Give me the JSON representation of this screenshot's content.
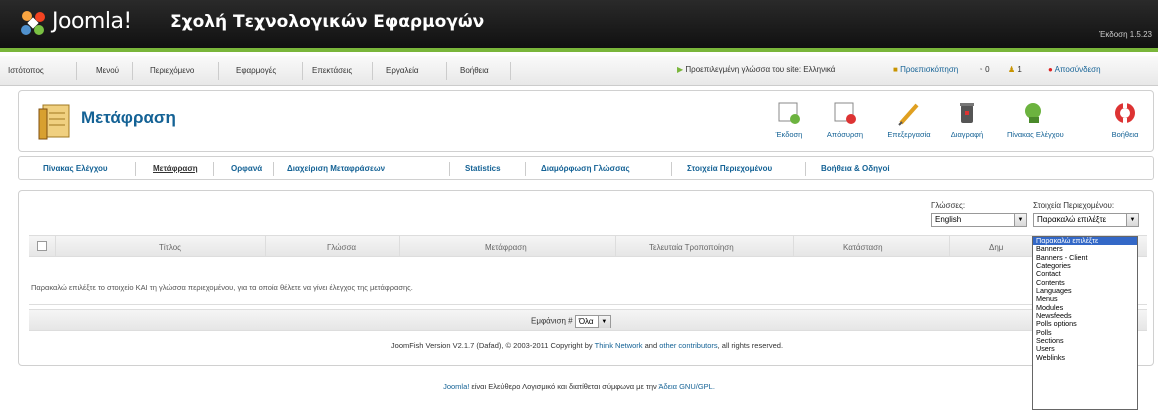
{
  "header": {
    "logo_text": "Joomla!",
    "site_name": "Σχολή Τεχνολογικών Εφαρμογών",
    "version": "Έκδοση 1.5.23"
  },
  "menu": {
    "items": [
      "Ιστότοπος",
      "Μενού",
      "Περιεχόμενο",
      "Εφαρμογές",
      "Επεκτάσεις",
      "Εργαλεία",
      "Βοήθεια"
    ],
    "default_lang": "Προεπιλεγμένη γλώσσα του site: Ελληνικά",
    "preview": "Προεπισκόπηση",
    "messages": "0",
    "users": "1",
    "logout": "Αποσύνδεση"
  },
  "toolbar": {
    "title": "Μετάφραση",
    "buttons": [
      "Έκδοση",
      "Απόσυρση",
      "Επεξεργασία",
      "Διαγραφή",
      "Πίνακας Ελέγχου",
      "Βοήθεια"
    ]
  },
  "subnav": {
    "items": [
      "Πίνακας Ελέγχου",
      "Μετάφραση",
      "Ορφανά",
      "Διαχείριση Μεταφράσεων",
      "Statistics",
      "Διαμόρφωση Γλώσσας",
      "Στοιχεία Περιεχομένου",
      "Βοήθεια & Οδηγοί"
    ]
  },
  "filters": {
    "languages_label": "Γλώσσες:",
    "languages_value": "English",
    "content_label": "Στοιχεία Περιεχομένου:",
    "content_value": "Παρακαλώ επιλέξτε"
  },
  "table": {
    "columns": [
      "Τίτλος",
      "Γλώσσα",
      "Μετάφραση",
      "Τελευταία Τροποποίηση",
      "Κατάσταση",
      "Δημ"
    ],
    "message": "Παρακαλώ επιλέξτε το στοιχείο ΚΑΙ τη γλώσσα περιεχομένου, για τα οποία θέλετε να γίνει έλεγχος της μετάφρασης.",
    "display_label": "Εμφάνιση #",
    "display_value": "Όλα"
  },
  "copyright": {
    "prefix": "JoomFish Version V2.1.7 (Dafad), © 2003-2011 Copyright by",
    "link1": "Think Network",
    "middle": "and",
    "link2": "other contributors",
    "suffix": ", all rights reserved."
  },
  "footer": {
    "link1": "Joomla!",
    "text": "είναι Ελεύθερο Λογισμικό και διατίθεται σύμφωνα με την",
    "link2": "Άδεια GNU/GPL."
  },
  "dropdown_options": [
    "Παρακαλώ επιλέξτε",
    "Banners",
    "Banners - Client",
    "Categories",
    "Contact",
    "Contents",
    "Languages",
    "Menus",
    "Modules",
    "Newsfeeds",
    "Polls options",
    "Polls",
    "Sections",
    "Users",
    "Weblinks"
  ]
}
